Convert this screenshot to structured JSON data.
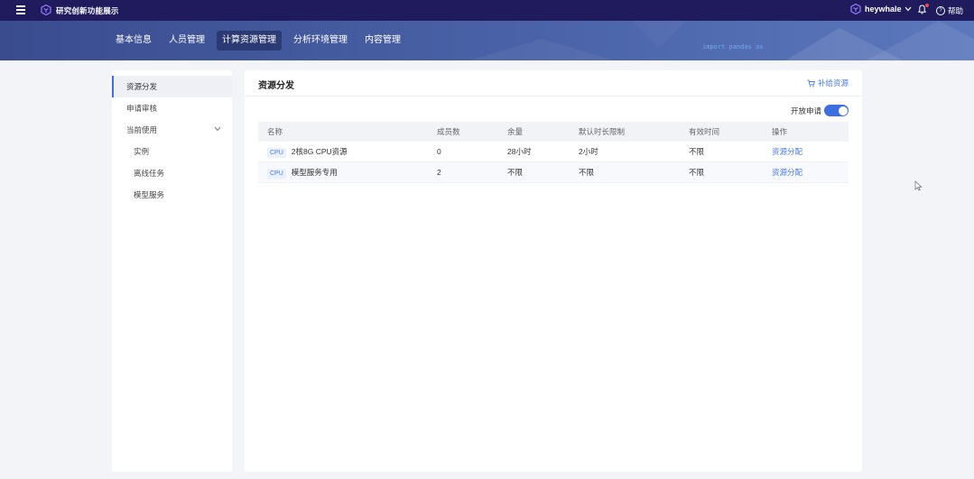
{
  "topbar": {
    "app_title": "研究创新功能展示",
    "user_name": "heywhale",
    "help_label": "帮助"
  },
  "navbar": {
    "tabs": [
      {
        "label": "基本信息",
        "active": false
      },
      {
        "label": "人员管理",
        "active": false
      },
      {
        "label": "计算资源管理",
        "active": true
      },
      {
        "label": "分析环境管理",
        "active": false
      },
      {
        "label": "内容管理",
        "active": false
      }
    ],
    "code_decoration": "import pandas as"
  },
  "sidebar": {
    "items": [
      {
        "label": "资源分发",
        "active": true
      },
      {
        "label": "申请审核",
        "active": false
      },
      {
        "label": "当前使用",
        "active": false
      },
      {
        "label": "实例",
        "sub": true
      },
      {
        "label": "离线任务",
        "sub": true
      },
      {
        "label": "模型服务",
        "sub": true
      }
    ]
  },
  "main": {
    "title": "资源分发",
    "supplement_link": "补给资源",
    "toggle_label": "开放申请",
    "toggle_on": true,
    "table": {
      "headers": [
        "名称",
        "成员数",
        "余量",
        "默认时长限制",
        "有效时间",
        "操作"
      ],
      "rows": [
        {
          "tag": "CPU",
          "name": "2核8G CPU资源",
          "members": "0",
          "remaining": "28小时",
          "limit": "2小时",
          "valid": "不限",
          "action": "资源分配"
        },
        {
          "tag": "CPU",
          "name": "模型服务专用",
          "members": "2",
          "remaining": "不限",
          "limit": "不限",
          "valid": "不限",
          "action": "资源分配"
        }
      ]
    }
  },
  "colors": {
    "topbar": "#1f1b5c",
    "accent": "#3d6fe0",
    "link": "#4a7be8"
  }
}
